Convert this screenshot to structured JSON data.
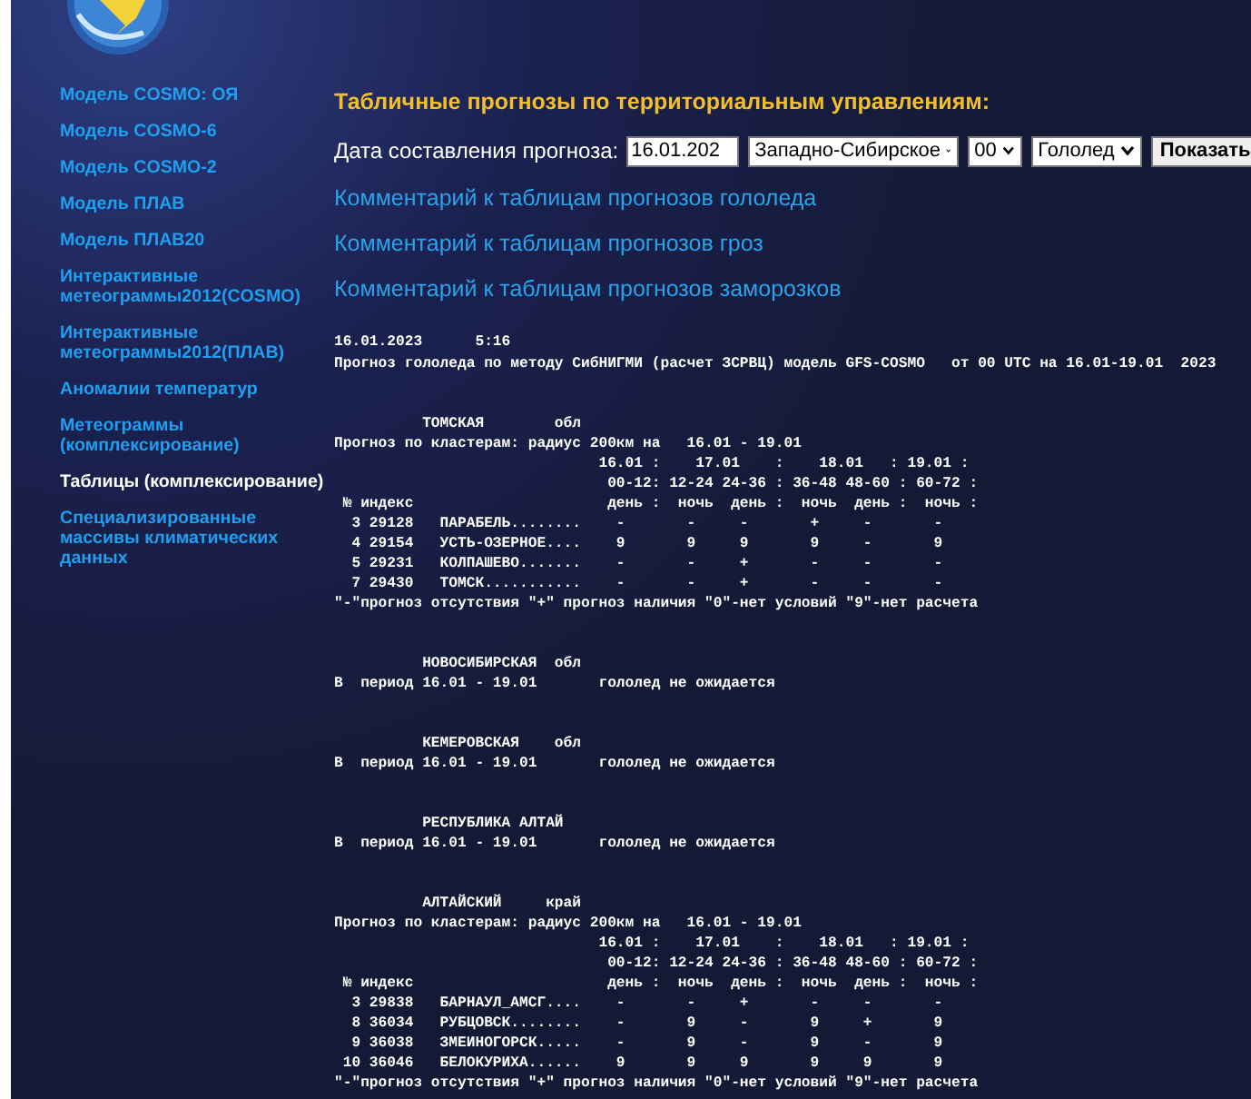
{
  "sidebar": {
    "items": [
      {
        "label": "Модель COSMO: ОЯ",
        "selected": false
      },
      {
        "label": "Модель COSMO-6",
        "selected": false
      },
      {
        "label": "Модель COSMO-2",
        "selected": false
      },
      {
        "label": "Модель ПЛАВ",
        "selected": false
      },
      {
        "label": "Модель ПЛАВ20",
        "selected": false
      },
      {
        "label": "Интерактивные метеограммы2012(COSMO)",
        "selected": false
      },
      {
        "label": "Интерактивные метеограммы2012(ПЛАВ)",
        "selected": false
      },
      {
        "label": "Аномалии температур",
        "selected": false
      },
      {
        "label": "Метеограммы (комплексирование)",
        "selected": false
      },
      {
        "label": "Таблицы (комплексирование)",
        "selected": true
      },
      {
        "label": "Специализированные массивы климатических данных",
        "selected": false
      }
    ]
  },
  "main": {
    "title": "Табличные прогнозы по территориальным управлениям:",
    "form": {
      "label": "Дата составления прогноза:",
      "date_value": "16.01.202",
      "region": "Западно-Сибирское",
      "hour": "00",
      "phenomenon": "Гололед",
      "button": "Показать"
    },
    "links": [
      "Комментарий к таблицам прогнозов гололеда",
      "Комментарий к таблицам прогнозов гроз",
      "Комментарий к таблицам прогнозов заморозков"
    ],
    "report": {
      "header_lines": [
        "16.01.2023      5:16",
        "Прогноз гололеда по методу СибНИГМИ (расчет ЗСРВЦ) модель GFS-COSMO   от 00 UTC на 16.01-19.01  2023"
      ],
      "sections": [
        {
          "lines": [
            "          ТОМСКАЯ        обл",
            "Прогноз по кластерам: радиус 200км на   16.01 - 19.01",
            "                              16.01 :    17.01    :    18.01   : 19.01 :",
            "                               00-12: 12-24 24-36 : 36-48 48-60 : 60-72 :",
            " № индекс                      день :  ночь  день :  ночь  день :  ночь :",
            "  3 29128   ПАРАБЕЛЬ........    -       -     -       +     -       -",
            "  4 29154   УСТЬ-ОЗЕРНОЕ....    9       9     9       9     -       9",
            "  5 29231   КОЛПАШЕВО.......    -       -     +       -     -       -",
            "  7 29430   ТОМСК...........    -       -     +       -     -       -",
            "\"-\"прогноз отсутствия \"+\" прогноз наличия \"0\"-нет условий \"9\"-нет расчета"
          ]
        },
        {
          "lines": [
            "          НОВОСИБИРСКАЯ  обл",
            "В  период 16.01 - 19.01       гололед не ожидается"
          ]
        },
        {
          "lines": [
            "          КЕМЕРОВСКАЯ    обл",
            "В  период 16.01 - 19.01       гололед не ожидается"
          ]
        },
        {
          "lines": [
            "          РЕСПУБЛИКА АЛТАЙ",
            "В  период 16.01 - 19.01       гололед не ожидается"
          ]
        },
        {
          "lines": [
            "          АЛТАЙСКИЙ     край",
            "Прогноз по кластерам: радиус 200км на   16.01 - 19.01",
            "                              16.01 :    17.01    :    18.01   : 19.01 :",
            "                               00-12: 12-24 24-36 : 36-48 48-60 : 60-72 :",
            " № индекс                      день :  ночь  день :  ночь  день :  ночь :",
            "  3 29838   БАРНАУЛ_АМСГ....    -       -     +       -     -       -",
            "  8 36034   РУБЦОВСК........    -       9     -       9     +       9",
            "  9 36038   ЗМЕИНОГОРСК.....    -       9     -       9     -       9",
            " 10 36046   БЕЛОКУРИХА......    9       9     9       9     9       9",
            "\"-\"прогноз отсутствия \"+\" прогноз наличия \"0\"-нет условий \"9\"-нет расчета"
          ]
        }
      ]
    }
  }
}
